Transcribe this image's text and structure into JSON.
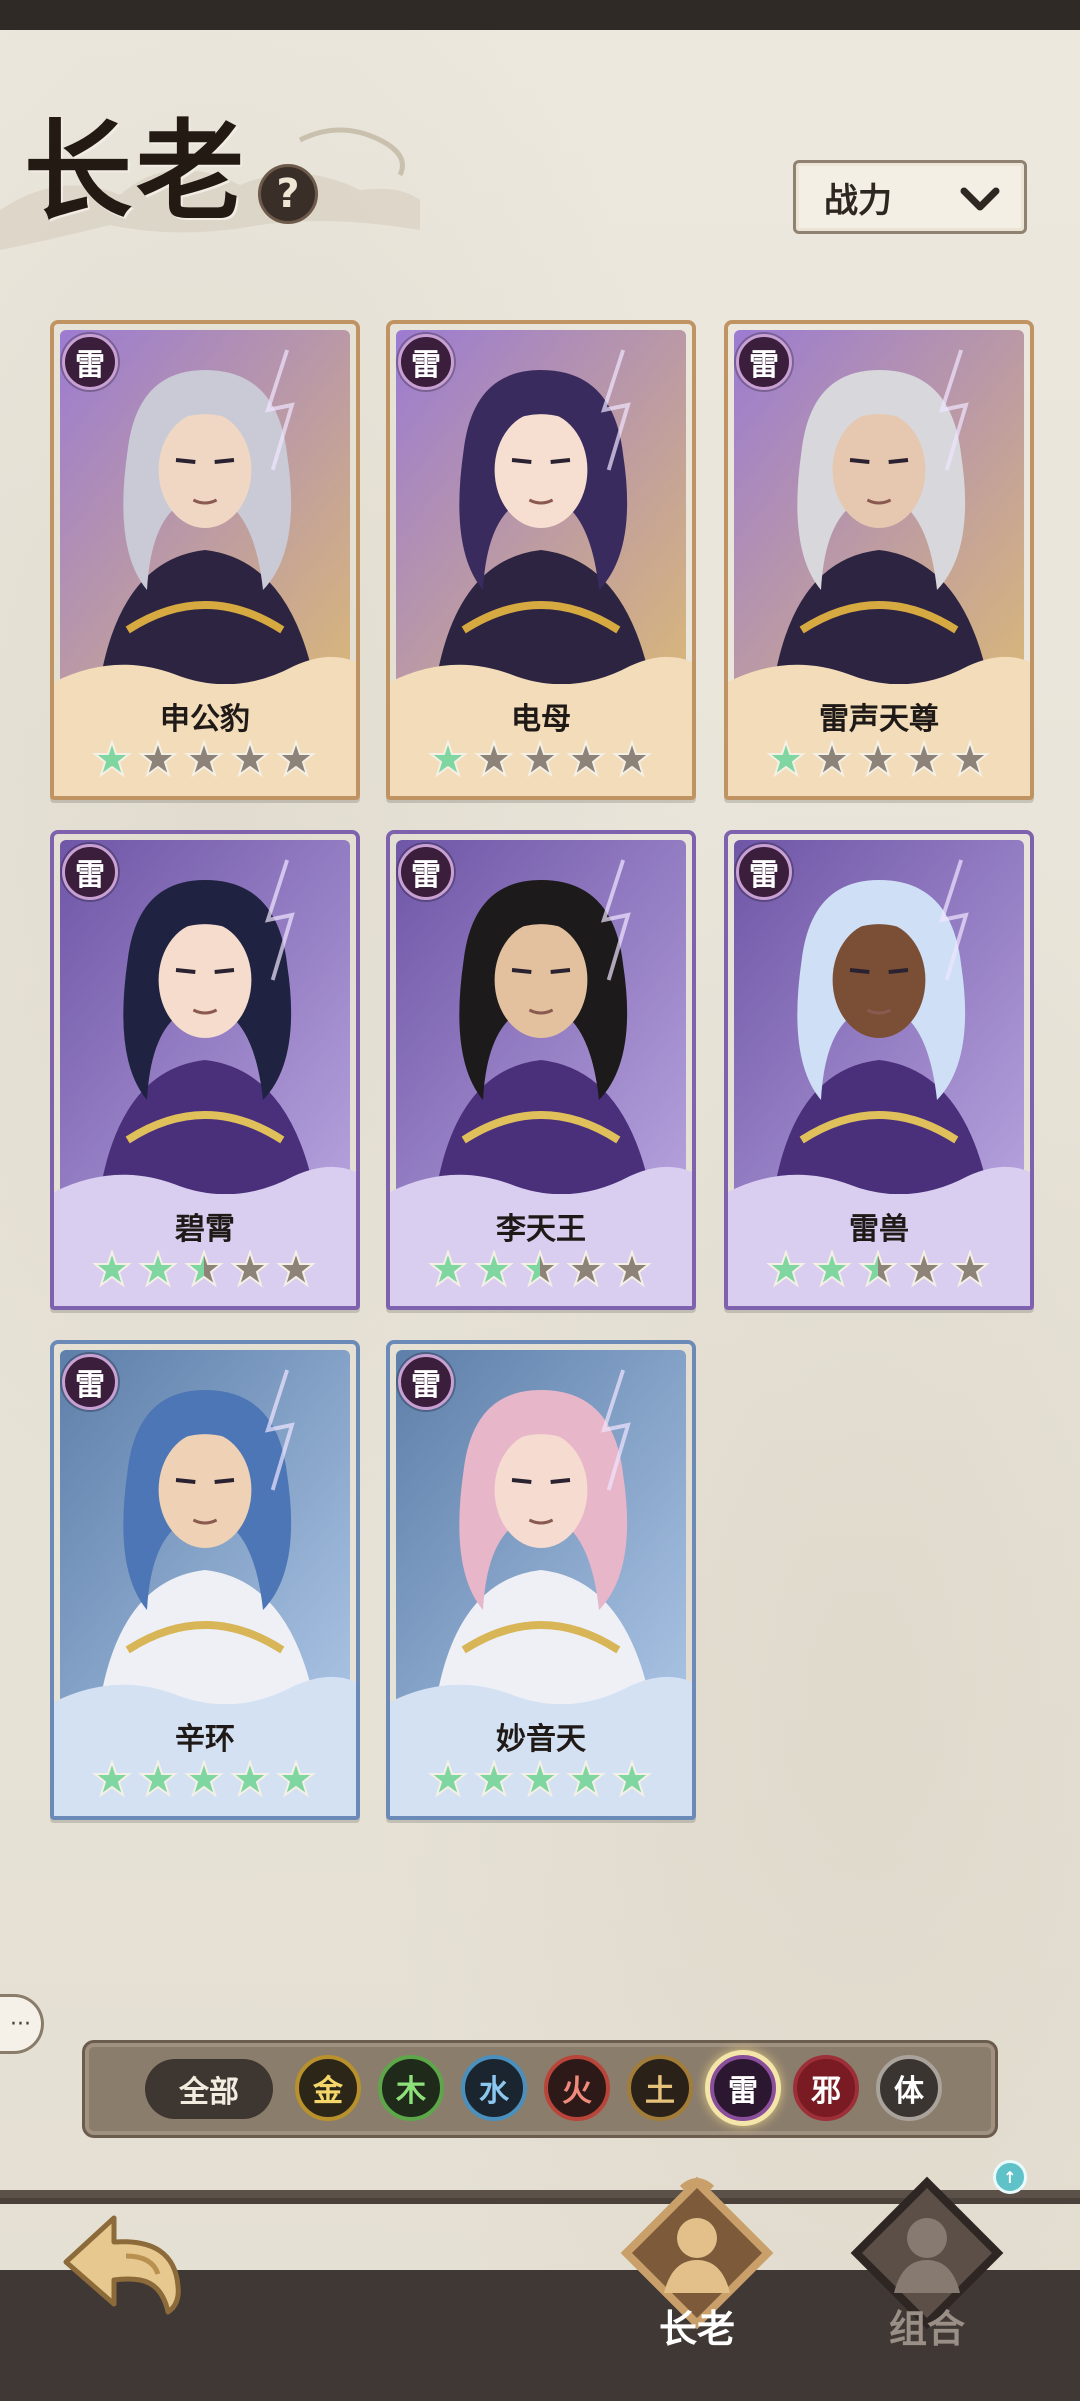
{
  "header": {
    "title": "长老",
    "help_label": "?",
    "sort": {
      "selected": "战力"
    }
  },
  "colors": {
    "gold_tier": "#c09462",
    "purple_tier": "#7f62ad",
    "blue_tier": "#6c8ab8",
    "star_lit": "#7fd6a1",
    "star_unlit": "#8d8379",
    "thunder_badge": "#3b1e3c"
  },
  "elders": [
    {
      "name": "申公豹",
      "element": "雷",
      "tier": "gold",
      "stars": 1,
      "max_stars": 5
    },
    {
      "name": "电母",
      "element": "雷",
      "tier": "gold",
      "stars": 1,
      "max_stars": 5
    },
    {
      "name": "雷声天尊",
      "element": "雷",
      "tier": "gold",
      "stars": 1,
      "max_stars": 5
    },
    {
      "name": "碧霄",
      "element": "雷",
      "tier": "purple",
      "stars": 2.5,
      "max_stars": 5
    },
    {
      "name": "李天王",
      "element": "雷",
      "tier": "purple",
      "stars": 2.5,
      "max_stars": 5
    },
    {
      "name": "雷兽",
      "element": "雷",
      "tier": "purple",
      "stars": 2.5,
      "max_stars": 5
    },
    {
      "name": "辛环",
      "element": "雷",
      "tier": "blue",
      "stars": 5,
      "max_stars": 5
    },
    {
      "name": "妙音天",
      "element": "雷",
      "tier": "blue",
      "stars": 5,
      "max_stars": 5
    }
  ],
  "filters": {
    "all_label": "全部",
    "elements": [
      {
        "label": "金",
        "active": false
      },
      {
        "label": "木",
        "active": false
      },
      {
        "label": "水",
        "active": false
      },
      {
        "label": "火",
        "active": false
      },
      {
        "label": "土",
        "active": false
      },
      {
        "label": "雷",
        "active": true
      },
      {
        "label": "邪",
        "active": false
      },
      {
        "label": "体",
        "active": false
      }
    ]
  },
  "chat": {
    "icon": "chat-bubble-icon"
  },
  "bottom_nav": {
    "back_icon": "back-arrow-icon",
    "tabs": [
      {
        "label": "长老",
        "active": true,
        "icon": "elder-portrait-icon"
      },
      {
        "label": "组合",
        "active": false,
        "icon": "team-portrait-icon"
      }
    ],
    "notify_icon": "upgrade-arrow-icon"
  }
}
